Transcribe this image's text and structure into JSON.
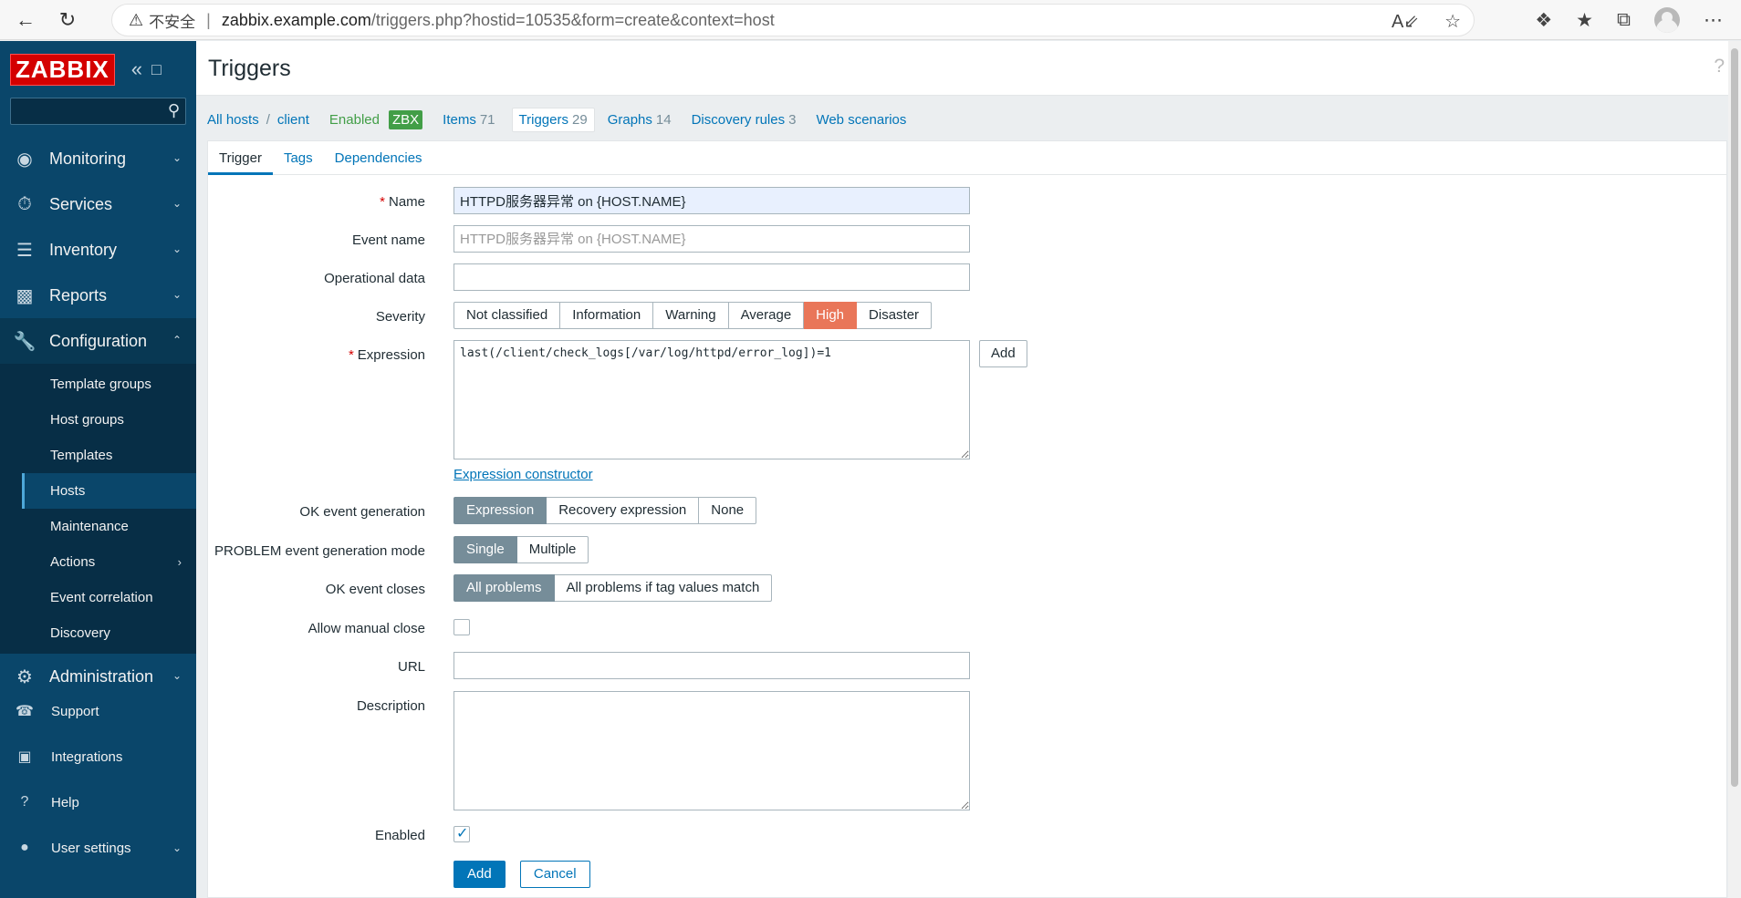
{
  "browser": {
    "insecure_label": "不安全",
    "url_host": "zabbix.example.com",
    "url_path": "/triggers.php?hostid=10535&form=create&context=host"
  },
  "sidebar": {
    "logo": "ZABBIX",
    "menu": [
      {
        "label": "Monitoring",
        "icon": "eye-icon"
      },
      {
        "label": "Services",
        "icon": "clock-icon"
      },
      {
        "label": "Inventory",
        "icon": "list-icon"
      },
      {
        "label": "Reports",
        "icon": "chart-icon"
      },
      {
        "label": "Configuration",
        "icon": "wrench-icon"
      }
    ],
    "config_submenu": [
      "Template groups",
      "Host groups",
      "Templates",
      "Hosts",
      "Maintenance",
      "Actions",
      "Event correlation",
      "Discovery"
    ],
    "administration": "Administration",
    "bottom": [
      "Support",
      "Integrations",
      "Help",
      "User settings"
    ]
  },
  "header": {
    "title": "Triggers"
  },
  "host_nav": {
    "all_hosts": "All hosts",
    "host": "client",
    "enabled": "Enabled",
    "zbx": "ZBX",
    "items_label": "Items",
    "items_count": "71",
    "triggers_label": "Triggers",
    "triggers_count": "29",
    "graphs_label": "Graphs",
    "graphs_count": "14",
    "discovery_label": "Discovery rules",
    "discovery_count": "3",
    "web_label": "Web scenarios"
  },
  "tabs": [
    "Trigger",
    "Tags",
    "Dependencies"
  ],
  "form": {
    "name_label": "Name",
    "name_value": "HTTPD服务器异常 on {HOST.NAME}",
    "event_name_label": "Event name",
    "event_name_placeholder": "HTTPD服务器异常 on {HOST.NAME}",
    "opdata_label": "Operational data",
    "severity_label": "Severity",
    "severities": [
      "Not classified",
      "Information",
      "Warning",
      "Average",
      "High",
      "Disaster"
    ],
    "severity_selected": "High",
    "expression_label": "Expression",
    "expression_value": "last(/client/check_logs[/var/log/httpd/error_log])=1",
    "add_label": "Add",
    "expr_constructor": "Expression constructor",
    "ok_gen_label": "OK event generation",
    "ok_gen_options": [
      "Expression",
      "Recovery expression",
      "None"
    ],
    "problem_mode_label": "PROBLEM event generation mode",
    "problem_mode_options": [
      "Single",
      "Multiple"
    ],
    "ok_closes_label": "OK event closes",
    "ok_closes_options": [
      "All problems",
      "All problems if tag values match"
    ],
    "manual_close_label": "Allow manual close",
    "url_label": "URL",
    "description_label": "Description",
    "enabled_label": "Enabled",
    "submit_label": "Add",
    "cancel_label": "Cancel"
  },
  "colors": {
    "sidebar_bg": "#0a466a",
    "link": "#0275b8",
    "severity_high": "#e97659",
    "enabled_green": "#429e47"
  }
}
